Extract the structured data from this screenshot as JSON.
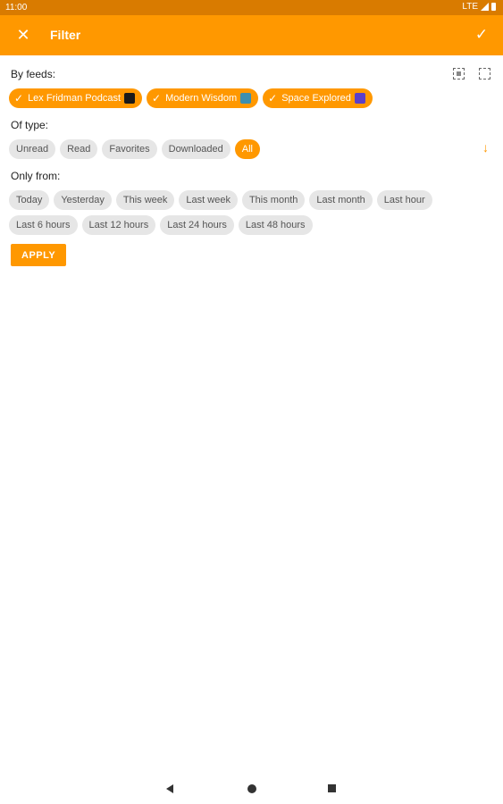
{
  "status": {
    "time": "11:00",
    "network": "LTE"
  },
  "app_bar": {
    "title": "Filter",
    "close_icon": "close-icon",
    "confirm_icon": "check-icon"
  },
  "feeds": {
    "label": "By feeds:",
    "chips": [
      {
        "label": "Lex Fridman Podcast",
        "selected": true,
        "thumb_color": "#1a1a1a"
      },
      {
        "label": "Modern Wisdom",
        "selected": true,
        "thumb_color": "#3d8fb0"
      },
      {
        "label": "Space Explored",
        "selected": true,
        "thumb_color": "#5b3fc9"
      }
    ],
    "select_all_icon": "select-all-icon",
    "deselect_all_icon": "deselect-all-icon"
  },
  "type": {
    "label": "Of type:",
    "chips": [
      {
        "label": "Unread",
        "selected": false
      },
      {
        "label": "Read",
        "selected": false
      },
      {
        "label": "Favorites",
        "selected": false
      },
      {
        "label": "Downloaded",
        "selected": false
      },
      {
        "label": "All",
        "selected": true
      }
    ],
    "sort_icon": "arrow-down-icon"
  },
  "time": {
    "label": "Only from:",
    "row1": [
      "Today",
      "Yesterday",
      "This week",
      "Last week",
      "This month",
      "Last month",
      "Last hour"
    ],
    "row2": [
      "Last 6 hours",
      "Last 12 hours",
      "Last 24 hours",
      "Last 48 hours"
    ]
  },
  "apply_label": "APPLY",
  "colors": {
    "accent": "#ff9800",
    "status_bar": "#d97b00",
    "chip_bg": "#e6e6e6"
  }
}
